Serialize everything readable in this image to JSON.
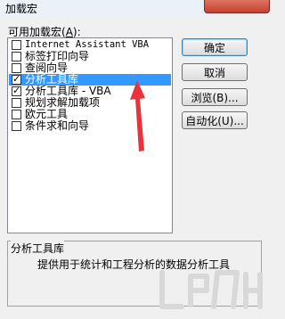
{
  "window": {
    "title": "加载宏"
  },
  "addins_list": {
    "label_prefix": "可用加载宏(",
    "label_access_key": "A",
    "label_suffix": "):",
    "items": [
      {
        "label": "Internet Assistant VBA",
        "checked": false,
        "selected": false
      },
      {
        "label": "标签打印向导",
        "checked": false,
        "selected": false
      },
      {
        "label": "查阅向导",
        "checked": false,
        "selected": false
      },
      {
        "label": "分析工具库",
        "checked": true,
        "selected": true
      },
      {
        "label": "分析工具库 - VBA",
        "checked": true,
        "selected": false
      },
      {
        "label": "规划求解加载项",
        "checked": false,
        "selected": false
      },
      {
        "label": "欧元工具",
        "checked": false,
        "selected": false
      },
      {
        "label": "条件求和向导",
        "checked": false,
        "selected": false
      }
    ]
  },
  "buttons": {
    "ok": "确定",
    "cancel": "取消",
    "browse": "浏览(B)...",
    "automation": "自动化(U)..."
  },
  "details": {
    "name": "分析工具库",
    "description": "提供用于统计和工程分析的数据分析工具"
  },
  "colors": {
    "selection": "#3399ff",
    "annotation_arrow": "#e8333a"
  }
}
